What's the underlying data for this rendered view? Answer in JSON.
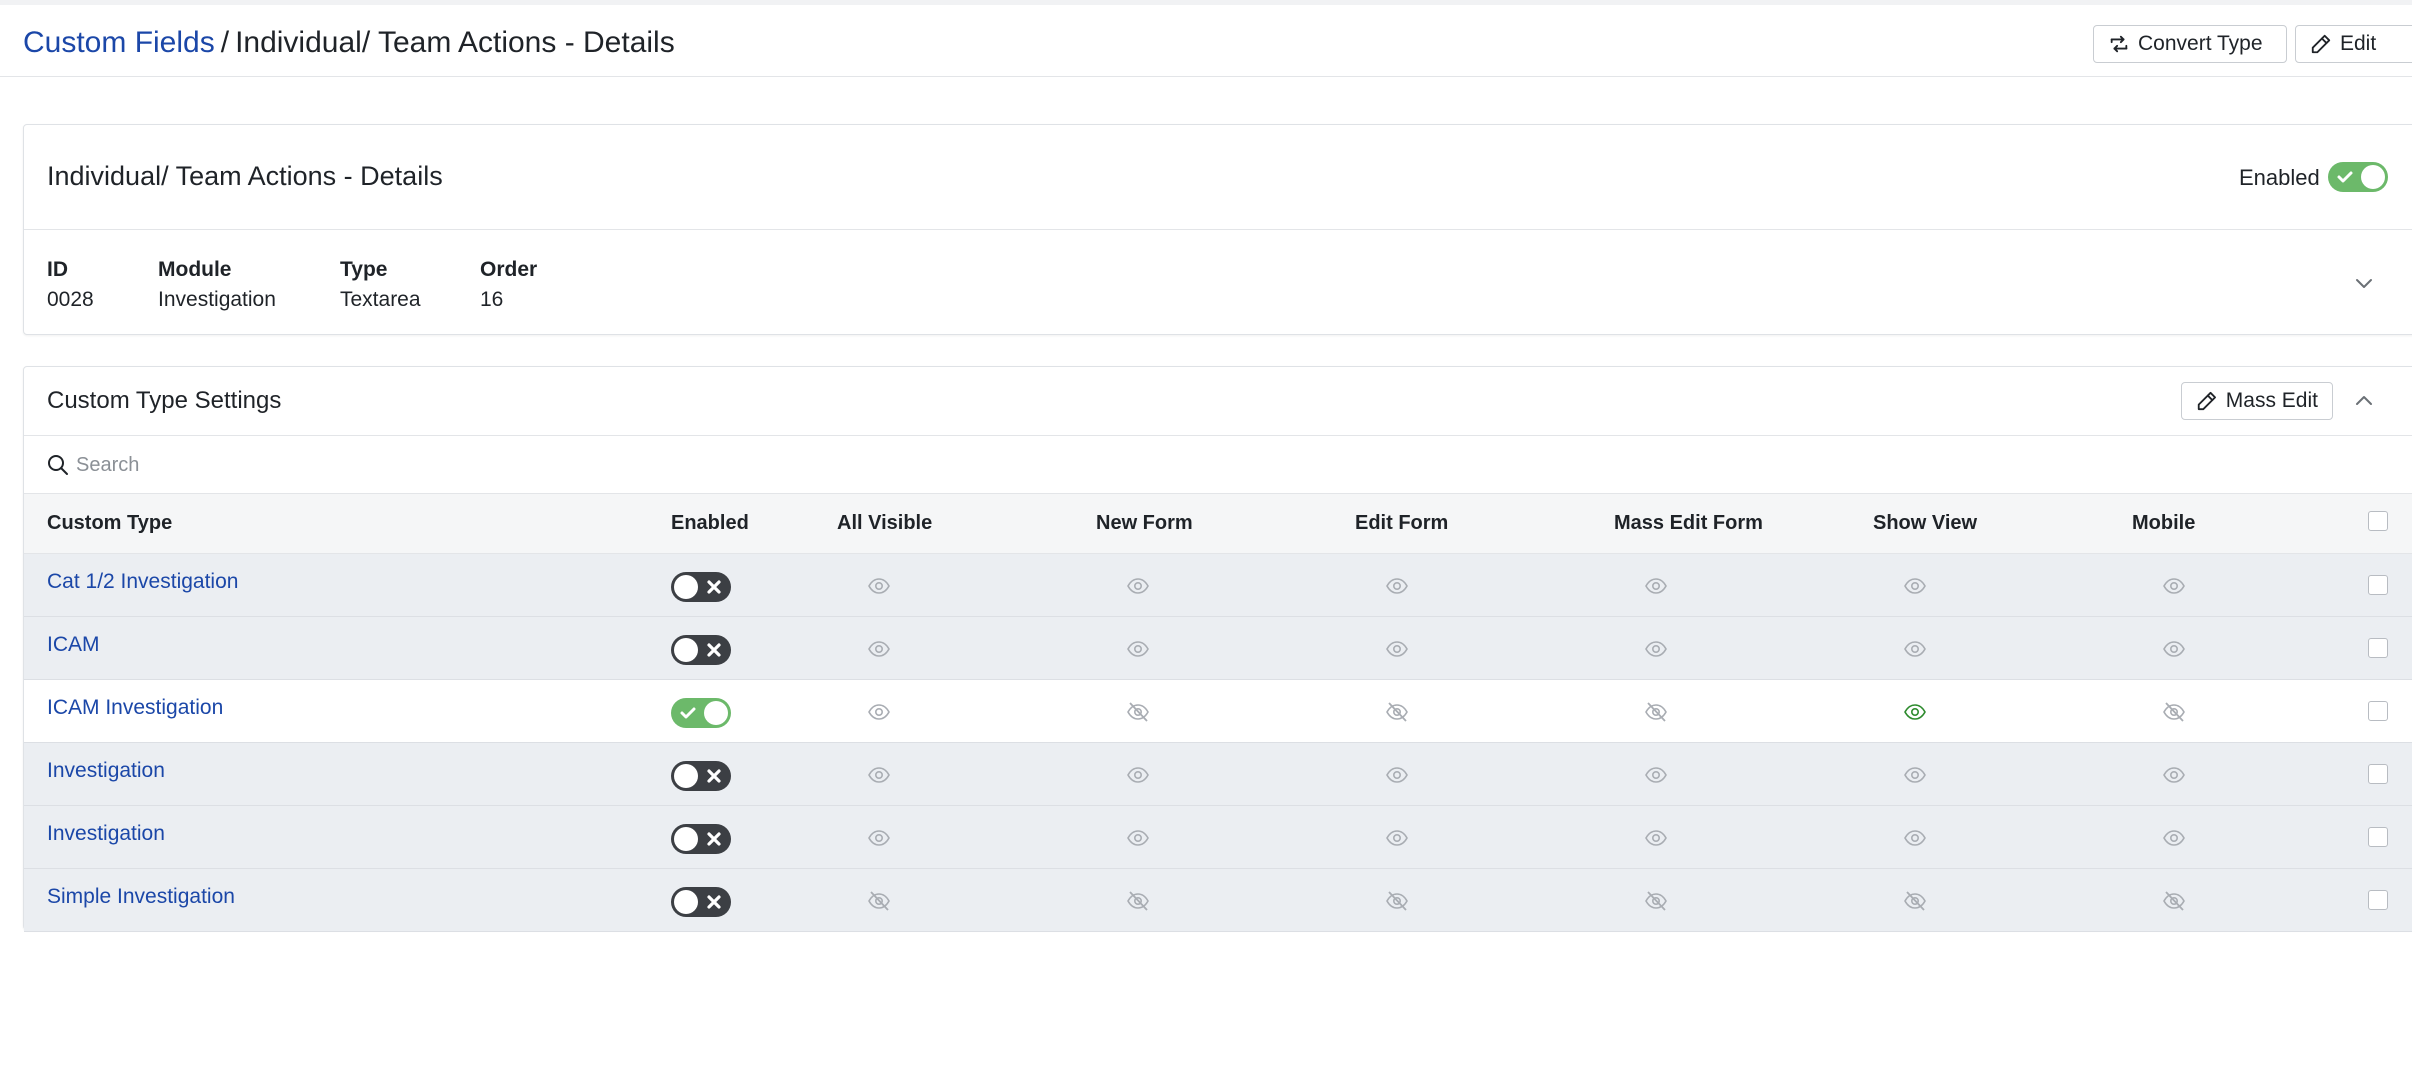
{
  "breadcrumb": {
    "parent": "Custom Fields",
    "separator": "/",
    "current": "Individual/ Team Actions - Details"
  },
  "toolbar": {
    "convert_label": "Convert Type",
    "edit_label": "Edit"
  },
  "details": {
    "title": "Individual/ Team Actions - Details",
    "enabled_label": "Enabled",
    "enabled": true,
    "fields": [
      {
        "label": "ID",
        "value": "0028"
      },
      {
        "label": "Module",
        "value": "Investigation"
      },
      {
        "label": "Type",
        "value": "Textarea"
      },
      {
        "label": "Order",
        "value": "16"
      }
    ]
  },
  "settings": {
    "title": "Custom Type Settings",
    "mass_edit_label": "Mass Edit",
    "search_placeholder": "Search",
    "columns": [
      "Custom Type",
      "Enabled",
      "All Visible",
      "New Form",
      "Edit Form",
      "Mass Edit Form",
      "Show View",
      "Mobile"
    ],
    "rows": [
      {
        "name": "Cat 1/2 Investigation",
        "enabled": false,
        "visibility": [
          "visible",
          "visible",
          "visible",
          "visible",
          "visible",
          "visible"
        ]
      },
      {
        "name": "ICAM",
        "enabled": false,
        "visibility": [
          "visible",
          "visible",
          "visible",
          "visible",
          "visible",
          "visible"
        ]
      },
      {
        "name": "ICAM Investigation",
        "enabled": true,
        "visibility": [
          "visible",
          "hidden",
          "hidden",
          "hidden",
          "visible-active",
          "hidden"
        ]
      },
      {
        "name": "Investigation",
        "enabled": false,
        "visibility": [
          "visible",
          "visible",
          "visible",
          "visible",
          "visible",
          "visible"
        ]
      },
      {
        "name": "Investigation",
        "enabled": false,
        "visibility": [
          "visible",
          "visible",
          "visible",
          "visible",
          "visible",
          "visible"
        ]
      },
      {
        "name": "Simple Investigation",
        "enabled": false,
        "visibility": [
          "hidden",
          "hidden",
          "hidden",
          "hidden",
          "hidden",
          "hidden"
        ]
      }
    ]
  },
  "colors": {
    "link": "#1b47a8",
    "toggle_on": "#6cb96a",
    "toggle_off": "#3c3f44",
    "eye_active": "#2e8b2e",
    "eye_muted": "#a9adb3"
  },
  "icons": {
    "convert": "swap-arrows-icon",
    "edit": "pencil-icon",
    "search": "search-icon",
    "visible": "eye-icon",
    "hidden": "eye-slash-icon"
  }
}
